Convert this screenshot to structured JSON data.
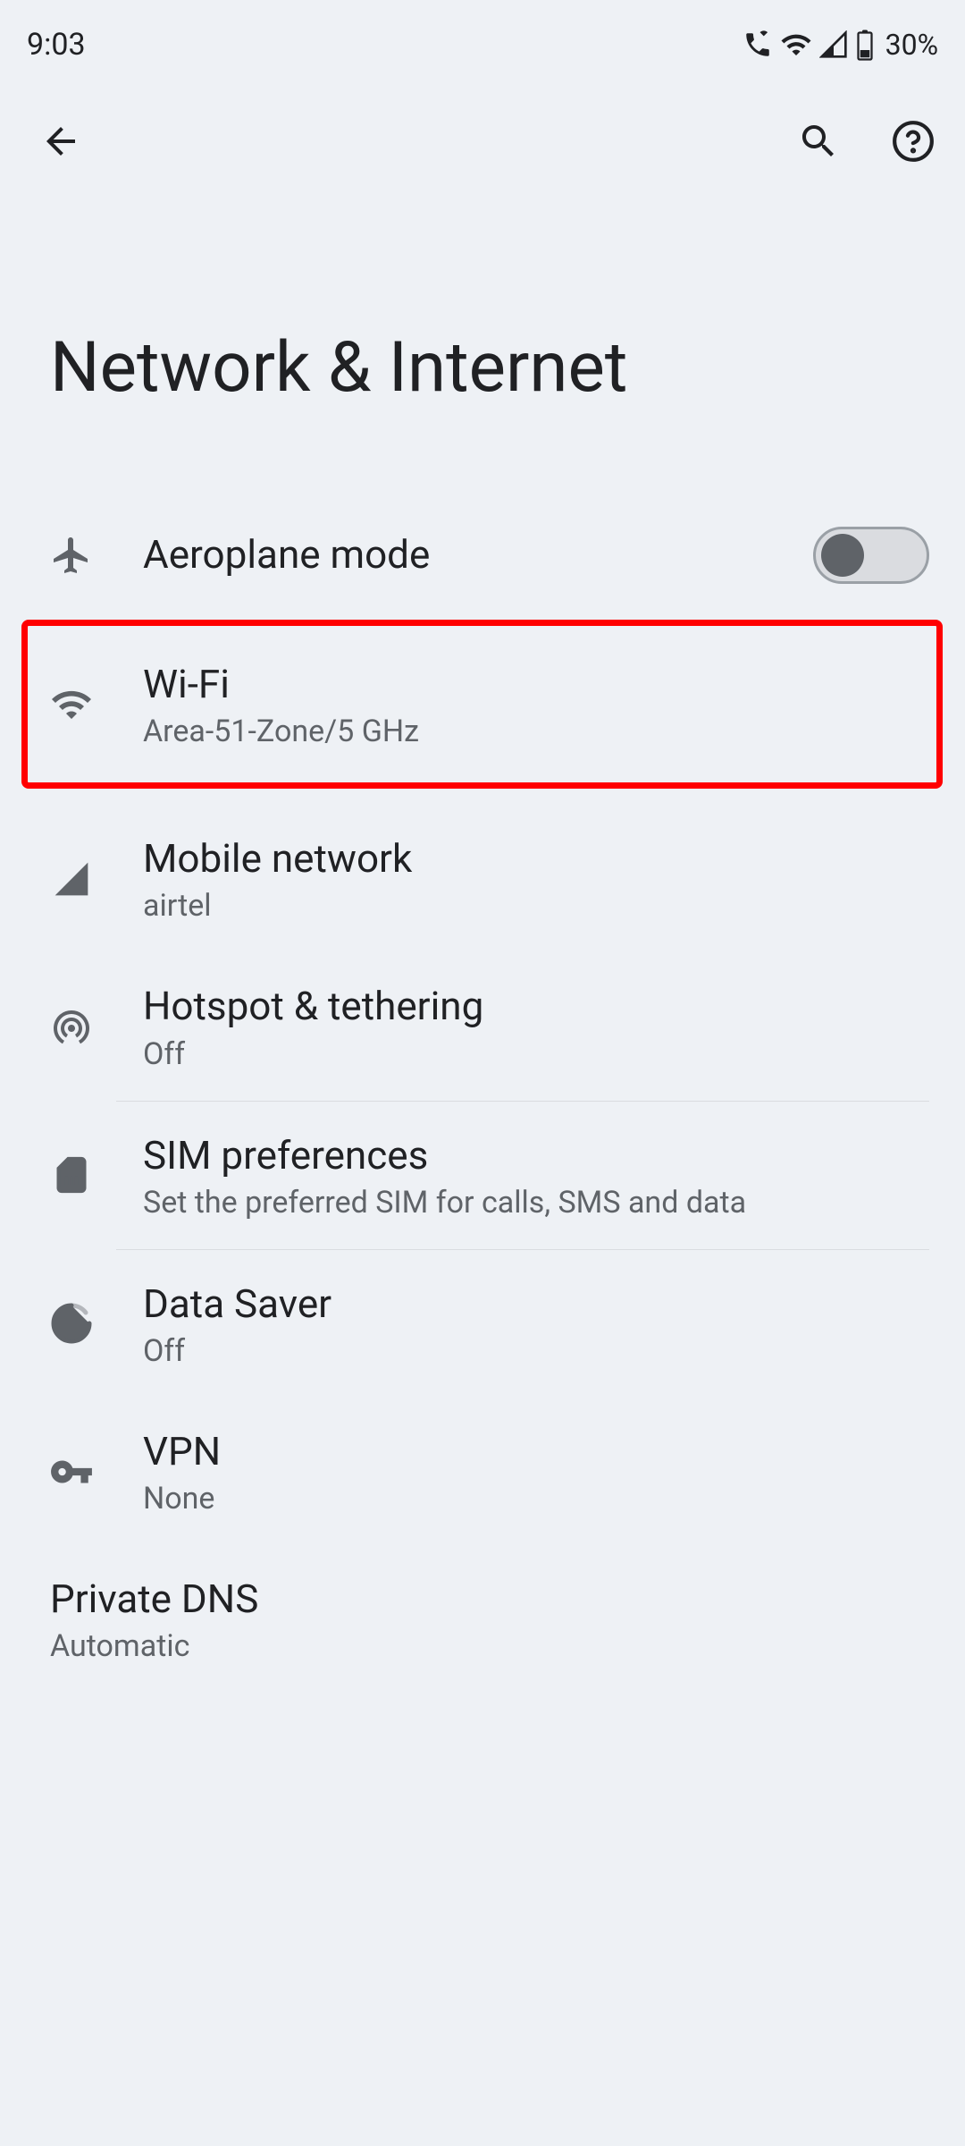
{
  "status_bar": {
    "time": "9:03",
    "battery": "30%"
  },
  "page": {
    "title": "Network & Internet"
  },
  "settings": {
    "aeroplane": {
      "title": "Aeroplane mode"
    },
    "wifi": {
      "title": "Wi-Fi",
      "subtitle": "Area-51-Zone/5 GHz"
    },
    "mobile": {
      "title": "Mobile network",
      "subtitle": "airtel"
    },
    "hotspot": {
      "title": "Hotspot & tethering",
      "subtitle": "Off"
    },
    "sim": {
      "title": "SIM preferences",
      "subtitle": "Set the preferred SIM for calls, SMS and data"
    },
    "data_saver": {
      "title": "Data Saver",
      "subtitle": "Off"
    },
    "vpn": {
      "title": "VPN",
      "subtitle": "None"
    },
    "private_dns": {
      "title": "Private DNS",
      "subtitle": "Automatic"
    }
  }
}
